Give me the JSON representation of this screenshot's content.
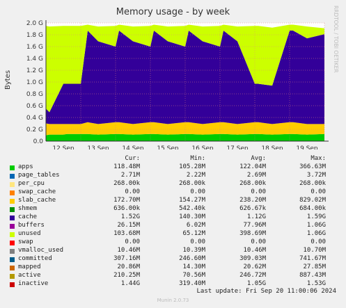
{
  "title": "Memory usage - by week",
  "side_label": "RRDTOOL / TOBI OETIKER",
  "chart_data": {
    "type": "area",
    "title": "Memory usage - by week",
    "ylabel": "Bytes",
    "ylim": [
      0,
      2.0
    ],
    "y_unit": "G",
    "yticks": [
      "0.0",
      "0.2 G",
      "0.4 G",
      "0.6 G",
      "0.8 G",
      "1.0 G",
      "1.2 G",
      "1.4 G",
      "1.6 G",
      "1.8 G",
      "2.0 G"
    ],
    "xticks": [
      "12 Sep",
      "13 Sep",
      "14 Sep",
      "15 Sep",
      "16 Sep",
      "17 Sep",
      "18 Sep",
      "19 Sep"
    ],
    "grid": true,
    "x": [
      0,
      0.1,
      0.5,
      0.6,
      1.0,
      1.2,
      1.5,
      2.0,
      2.1,
      2.5,
      3.0,
      3.1,
      3.5,
      4.0,
      4.1,
      4.5,
      5.0,
      5.1,
      5.5,
      6.0,
      6.1,
      6.5,
      7.0,
      7.1,
      7.5,
      8.0
    ],
    "series": [
      {
        "name": "apps",
        "values": [
          0.1,
          0.11,
          0.11,
          0.12,
          0.12,
          0.12,
          0.11,
          0.12,
          0.12,
          0.11,
          0.12,
          0.12,
          0.11,
          0.12,
          0.12,
          0.11,
          0.12,
          0.12,
          0.11,
          0.12,
          0.12,
          0.11,
          0.12,
          0.12,
          0.11,
          0.12
        ]
      },
      {
        "name": "slab_cache",
        "values": [
          0.2,
          0.18,
          0.18,
          0.17,
          0.17,
          0.2,
          0.18,
          0.2,
          0.2,
          0.18,
          0.2,
          0.2,
          0.18,
          0.2,
          0.2,
          0.18,
          0.2,
          0.2,
          0.18,
          0.2,
          0.2,
          0.18,
          0.2,
          0.2,
          0.18,
          0.17
        ]
      },
      {
        "name": "cache",
        "values": [
          0.25,
          0.2,
          0.68,
          0.68,
          0.68,
          1.55,
          1.4,
          1.28,
          1.55,
          1.4,
          1.28,
          1.55,
          1.4,
          1.28,
          1.55,
          1.4,
          1.28,
          1.55,
          1.4,
          0.65,
          0.65,
          0.65,
          1.55,
          1.55,
          1.45,
          1.52
        ]
      },
      {
        "name": "unused",
        "values": [
          1.4,
          1.45,
          0.98,
          0.98,
          0.98,
          0.1,
          0.25,
          0.35,
          0.1,
          0.25,
          0.35,
          0.1,
          0.25,
          0.35,
          0.1,
          0.25,
          0.35,
          0.1,
          0.25,
          0.98,
          0.98,
          0.98,
          0.1,
          0.1,
          0.2,
          0.1
        ]
      }
    ]
  },
  "legend_header": {
    "cur": "Cur:",
    "min": "Min:",
    "avg": "Avg:",
    "max": "Max:"
  },
  "legend": [
    {
      "name": "apps",
      "color": "#00cc00",
      "cur": "118.48M",
      "min": "105.28M",
      "avg": "122.04M",
      "max": "366.63M"
    },
    {
      "name": "page_tables",
      "color": "#0066b3",
      "cur": "2.71M",
      "min": "2.22M",
      "avg": "2.69M",
      "max": "3.72M"
    },
    {
      "name": "per_cpu",
      "color": "#ffe680",
      "cur": "268.00k",
      "min": "268.00k",
      "avg": "268.00k",
      "max": "268.00k"
    },
    {
      "name": "swap_cache",
      "color": "#ff8000",
      "cur": "0.00",
      "min": "0.00",
      "avg": "0.00",
      "max": "0.00"
    },
    {
      "name": "slab_cache",
      "color": "#ffcc00",
      "cur": "172.70M",
      "min": "154.27M",
      "avg": "238.20M",
      "max": "829.02M"
    },
    {
      "name": "shmem",
      "color": "#008f00",
      "cur": "636.00k",
      "min": "542.40k",
      "avg": "626.67k",
      "max": "684.00k"
    },
    {
      "name": "cache",
      "color": "#330099",
      "cur": "1.52G",
      "min": "140.30M",
      "avg": "1.12G",
      "max": "1.59G"
    },
    {
      "name": "buffers",
      "color": "#990099",
      "cur": "26.15M",
      "min": "6.02M",
      "avg": "77.96M",
      "max": "1.06G"
    },
    {
      "name": "unused",
      "color": "#ccff00",
      "cur": "103.68M",
      "min": "65.12M",
      "avg": "398.69M",
      "max": "1.06G"
    },
    {
      "name": "swap",
      "color": "#ff0000",
      "cur": "0.00",
      "min": "0.00",
      "avg": "0.00",
      "max": "0.00"
    },
    {
      "name": "vmalloc_used",
      "color": "#808080",
      "cur": "10.46M",
      "min": "10.39M",
      "avg": "10.46M",
      "max": "10.70M"
    },
    {
      "name": "committed",
      "color": "#005c8a",
      "cur": "307.16M",
      "min": "246.60M",
      "avg": "309.03M",
      "max": "741.67M"
    },
    {
      "name": "mapped",
      "color": "#cc6600",
      "cur": "20.86M",
      "min": "14.30M",
      "avg": "20.62M",
      "max": "27.85M"
    },
    {
      "name": "active",
      "color": "#b39900",
      "cur": "210.25M",
      "min": "70.56M",
      "avg": "246.72M",
      "max": "887.43M"
    },
    {
      "name": "inactive",
      "color": "#cc0000",
      "cur": "1.44G",
      "min": "319.40M",
      "avg": "1.05G",
      "max": "1.53G"
    }
  ],
  "last_update": "Last update: Fri Sep 20 11:00:06 2024",
  "footer": "Munin 2.0.73"
}
